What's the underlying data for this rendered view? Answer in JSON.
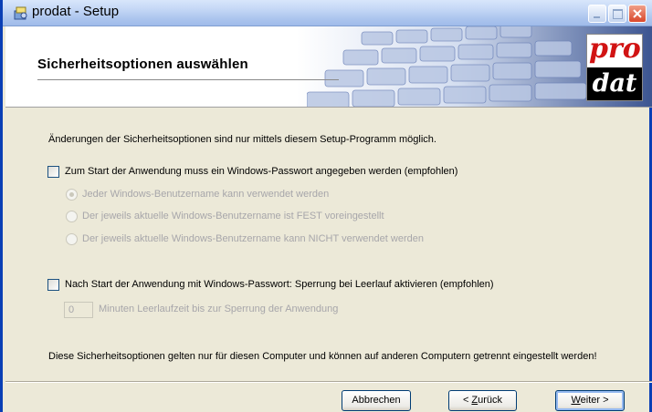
{
  "window": {
    "title": "prodat - Setup"
  },
  "header": {
    "title": "Sicherheitsoptionen auswählen",
    "logo_top": "pro",
    "logo_bottom": "dat"
  },
  "content": {
    "intro": "Änderungen der Sicherheitsoptionen sind nur mittels diesem Setup-Programm möglich.",
    "option1": {
      "label": "Zum Start der Anwendung muss ein Windows-Passwort angegeben werden (empfohlen)",
      "checked": false,
      "radios": [
        {
          "label": "Jeder Windows-Benutzername kann verwendet werden",
          "selected": true
        },
        {
          "label": "Der jeweils aktuelle Windows-Benutzername ist FEST voreingestellt",
          "selected": false
        },
        {
          "label": "Der jeweils aktuelle Windows-Benutzername kann NICHT verwendet werden",
          "selected": false
        }
      ]
    },
    "option2": {
      "label": "Nach Start der Anwendung mit Windows-Passwort: Sperrung bei Leerlauf aktivieren (empfohlen)",
      "checked": false,
      "minutes_value": "0",
      "minutes_label": "Minuten Leerlaufzeit bis zur Sperrung der Anwendung"
    },
    "footer_note": "Diese Sicherheitsoptionen gelten nur für diesen Computer und können auf anderen Computern getrennt eingestellt werden!"
  },
  "buttons": {
    "cancel": "Abbrechen",
    "back_prefix": "< ",
    "back_accel": "Z",
    "back_rest": "urück",
    "next_accel": "W",
    "next_rest": "eiter >"
  }
}
